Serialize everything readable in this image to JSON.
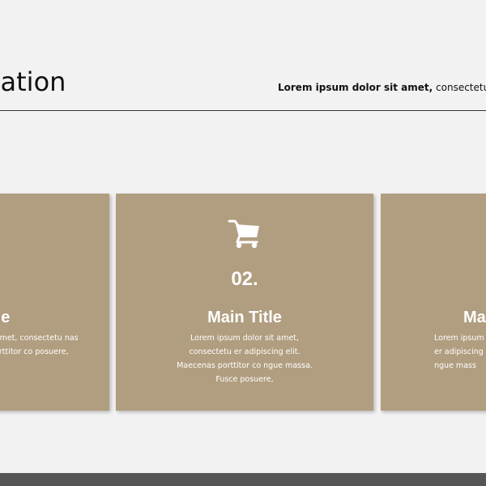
{
  "header": {
    "title": "entation",
    "subtitle_bold": "Lorem ipsum dolor sit amet,",
    "subtitle_rest": " consectetuer adipis"
  },
  "cards": [
    {
      "number": "",
      "title": "tle",
      "desc": "t amet, consectetu nas porttitor co posuere,"
    },
    {
      "number": "02.",
      "title": "Main Title",
      "desc": "Lorem ipsum dolor sit amet, consectetu er adipiscing elit. Maecenas porttitor co ngue massa. Fusce posuere,"
    },
    {
      "number": "",
      "title": "Ma",
      "desc": "Lorem ipsum d er adipiscing e ngue mass"
    }
  ],
  "colors": {
    "card_bg": "#b19e80",
    "bg": "#f2f2f2",
    "bottom_bar": "#555555"
  },
  "icons": {
    "card_middle": "shopping-cart-icon"
  }
}
